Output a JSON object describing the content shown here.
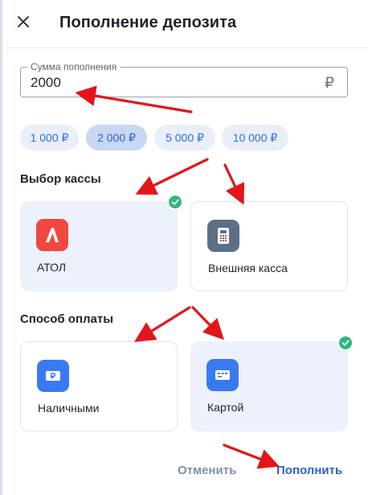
{
  "header": {
    "title": "Пополнение депозита",
    "close_icon": "close-icon"
  },
  "amount": {
    "label": "Сумма пополнения",
    "value": "2000",
    "currency_symbol": "₽"
  },
  "presets": [
    {
      "label": "1 000 ₽",
      "selected": false
    },
    {
      "label": "2 000 ₽",
      "selected": true
    },
    {
      "label": "5 000 ₽",
      "selected": false
    },
    {
      "label": "10 000 ₽",
      "selected": false
    }
  ],
  "register_section": {
    "title": "Выбор кассы",
    "options": [
      {
        "label": "АТОЛ",
        "icon": "atol-logo-icon",
        "selected": true
      },
      {
        "label": "Внешняя касса",
        "icon": "cash-register-icon",
        "selected": false
      }
    ]
  },
  "payment_section": {
    "title": "Способ оплаты",
    "options": [
      {
        "label": "Наличными",
        "icon": "cash-icon",
        "selected": false
      },
      {
        "label": "Картой",
        "icon": "card-icon",
        "selected": true
      }
    ]
  },
  "footer": {
    "cancel_label": "Отменить",
    "submit_label": "Пополнить"
  },
  "colors": {
    "accent": "#2d63c8",
    "chip_bg": "#e9eef8",
    "chip_active_bg": "#c9d7f2",
    "selected_card_bg": "#edf1fb",
    "check_green": "#2fb77c",
    "atol_red": "#f0483e",
    "annotation_arrow": "#e3151a"
  }
}
